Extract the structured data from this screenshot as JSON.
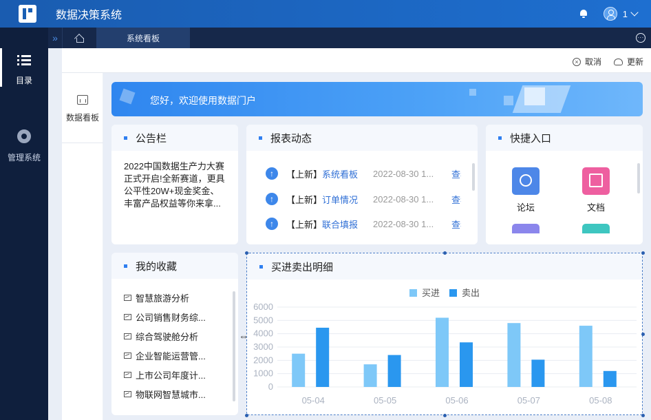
{
  "app": {
    "title": "数据决策系统"
  },
  "topbar": {
    "user_name": "1"
  },
  "sidebar": {
    "items": [
      {
        "label": "目录",
        "icon": "list-icon"
      },
      {
        "label": "管理系统",
        "icon": "gear-icon"
      }
    ]
  },
  "tabs": {
    "active": "系统看板"
  },
  "actions": {
    "cancel": "取消",
    "update": "更新"
  },
  "subnav": {
    "item": "数据看板"
  },
  "banner": {
    "text": "您好，欢迎使用数据门户"
  },
  "notice": {
    "title": "公告栏",
    "content": "2022中国数据生产力大赛正式开启!全新赛道，更具公平性20W+现金奖金、丰富产品权益等你来拿..."
  },
  "reports": {
    "title": "报表动态",
    "rows": [
      {
        "tag": "【上新】",
        "name": "系统看板",
        "date": "2022-08-30 1...",
        "action": "查看"
      },
      {
        "tag": "【上新】",
        "name": "订单情况",
        "date": "2022-08-30 1...",
        "action": "查看"
      },
      {
        "tag": "【上新】",
        "name": "联合填报",
        "date": "2022-08-30 1...",
        "action": "查看"
      }
    ]
  },
  "shortcuts": {
    "title": "快捷入口",
    "items": [
      {
        "label": "论坛",
        "color": "#4d87e8"
      },
      {
        "label": "文档",
        "color": "#ee5fa0"
      }
    ]
  },
  "favorites": {
    "title": "我的收藏",
    "items": [
      "智慧旅游分析",
      "公司销售财务综...",
      "综合驾驶舱分析",
      "企业智能运营管...",
      "上市公司年度计...",
      "物联网智慧城市..."
    ]
  },
  "chart_data": {
    "type": "bar",
    "title": "买进卖出明细",
    "categories": [
      "05-04",
      "05-05",
      "05-06",
      "05-07",
      "05-08"
    ],
    "series": [
      {
        "name": "买进",
        "values": [
          2500,
          1700,
          5200,
          4800,
          4600
        ],
        "color": "#7ec8f8"
      },
      {
        "name": "卖出",
        "values": [
          4450,
          2400,
          3350,
          2050,
          1200
        ],
        "color": "#2a97ef"
      }
    ],
    "ylim": [
      0,
      6000
    ],
    "yticks": [
      "0",
      "1000",
      "2000",
      "3000",
      "4000",
      "5000",
      "6000"
    ],
    "legend": "top-center",
    "grid": true
  }
}
